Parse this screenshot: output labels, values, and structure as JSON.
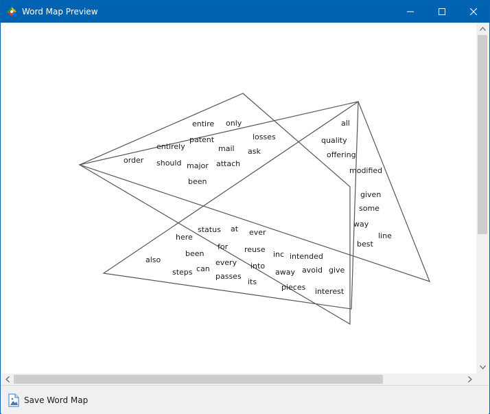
{
  "window": {
    "title": "Word Map Preview",
    "accent_color": "#0063b1",
    "icon": "app-logo-icon"
  },
  "controls": {
    "minimize_icon": "minimize-icon",
    "maximize_icon": "maximize-icon",
    "close_icon": "close-icon"
  },
  "word_map": {
    "shapes": [
      "triangle-1",
      "triangle-2",
      "triangle-3"
    ],
    "words": [
      "only",
      "entire",
      "losses",
      "patent",
      "mail",
      "entirely",
      "ask",
      "order",
      "should",
      "major",
      "attach",
      "been",
      "all",
      "quality",
      "offering",
      "modified",
      "given",
      "some",
      "way",
      "line",
      "best",
      "status",
      "at",
      "ever",
      "here",
      "for",
      "reuse",
      "been",
      "inc",
      "intended",
      "also",
      "every",
      "into",
      "avoid",
      "give",
      "steps",
      "can",
      "passes",
      "away",
      "its",
      "pieces",
      "interest"
    ]
  },
  "scrollbars": {
    "vertical": "vertical-scrollbar",
    "horizontal": "horizontal-scrollbar"
  },
  "footer": {
    "save_label": "Save Word Map",
    "save_icon": "save-image-icon"
  }
}
